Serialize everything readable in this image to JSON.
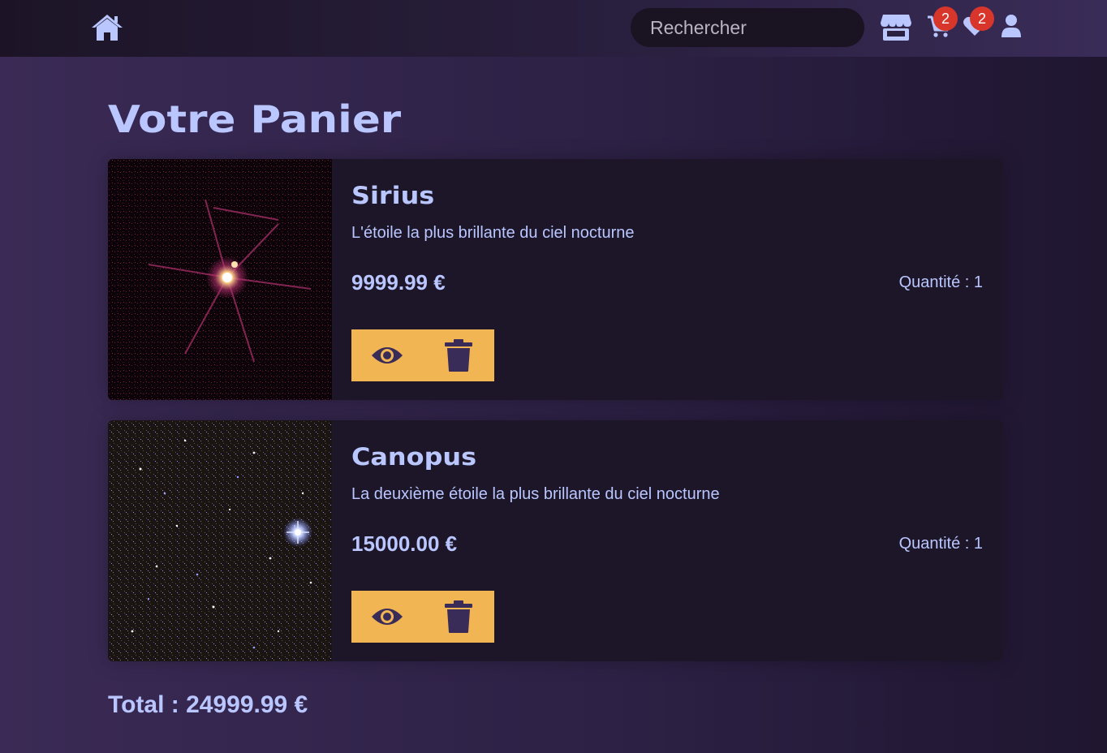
{
  "nav": {
    "search_placeholder": "Rechercher",
    "cart_count": "2",
    "favorites_count": "2"
  },
  "page": {
    "title": "Votre Panier"
  },
  "cart": {
    "items": [
      {
        "name": "Sirius",
        "description": "L'étoile la plus brillante du ciel nocturne",
        "price": "9999.99 €",
        "quantity": "Quantité : 1"
      },
      {
        "name": "Canopus",
        "description": "La deuxième étoile la plus brillante du ciel nocturne",
        "price": "15000.00 €",
        "quantity": "Quantité : 1"
      }
    ],
    "total": "Total : 24999.99 €"
  },
  "colors": {
    "accent": "#b9c6ff",
    "action_bar": "#f2b554",
    "badge": "#d8352b",
    "icon_dark": "#3a2c58"
  },
  "icons": [
    "home-icon",
    "store-icon",
    "cart-icon",
    "heart-icon",
    "user-icon",
    "eye-icon",
    "trash-icon"
  ]
}
